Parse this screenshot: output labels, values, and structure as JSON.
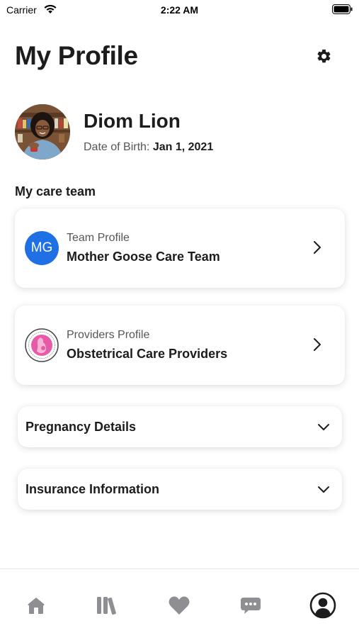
{
  "status_bar": {
    "carrier": "Carrier",
    "time": "2:22 AM"
  },
  "header": {
    "title": "My Profile",
    "settings_icon": "gear-icon"
  },
  "profile": {
    "name": "Diom Lion",
    "dob_label": "Date of Birth:",
    "dob_value": "Jan 1, 2021"
  },
  "care_team": {
    "section_title": "My care team",
    "cards": [
      {
        "icon_text": "MG",
        "icon_color": "#1f6fe5",
        "subtitle": "Team Profile",
        "title": "Mother Goose Care Team"
      },
      {
        "icon": "obstetrical-logo-icon",
        "icon_color": "#e85aa7",
        "subtitle": "Providers Profile",
        "title": "Obstetrical Care Providers"
      }
    ]
  },
  "accordions": [
    {
      "label": "Pregnancy Details",
      "icon": "chevron-down-icon"
    },
    {
      "label": "Insurance Information",
      "icon": "chevron-down-icon"
    }
  ],
  "tab_bar": {
    "icon_color": "#8e8e93",
    "active_color": "#1c1c1e",
    "tabs": [
      {
        "icon": "home-icon",
        "active": false
      },
      {
        "icon": "library-icon",
        "active": false
      },
      {
        "icon": "heart-icon",
        "active": false
      },
      {
        "icon": "chat-icon",
        "active": false
      },
      {
        "icon": "profile-icon",
        "active": true
      }
    ]
  }
}
